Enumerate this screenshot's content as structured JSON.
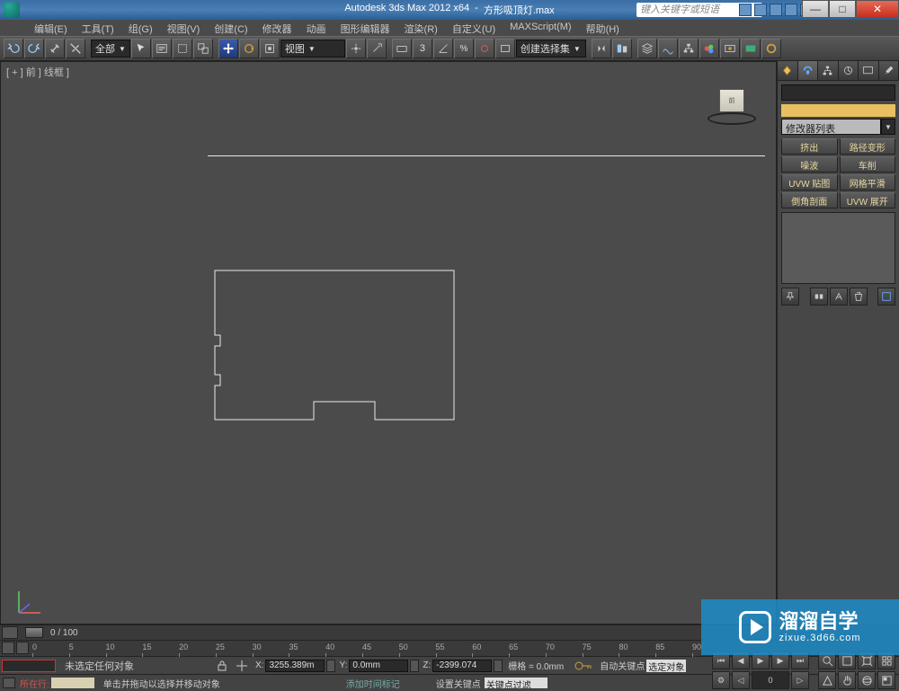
{
  "title": {
    "app": "Autodesk 3ds Max 2012 x64",
    "dash": "-",
    "file": "方形吸顶灯.max"
  },
  "search_placeholder": "键入关键字或短语",
  "menus": [
    "编辑(E)",
    "工具(T)",
    "组(G)",
    "视图(V)",
    "创建(C)",
    "修改器",
    "动画",
    "图形编辑器",
    "渲染(R)",
    "自定义(U)",
    "MAXScript(M)",
    "帮助(H)"
  ],
  "toolbar": {
    "sel_filter": "全部",
    "view_label": "视图",
    "three_label": "3",
    "named_sel": "创建选择集"
  },
  "viewport": {
    "label": "[ + ] 前 ] 线框 ]",
    "cube_face": "前"
  },
  "panel": {
    "modlist": "修改器列表",
    "buttons": [
      "挤出",
      "路径变形",
      "噪波",
      "车削",
      "UVW 贴图",
      "网格平滑",
      "倒角剖面",
      "UVW 展开"
    ]
  },
  "track": {
    "frames": "0 / 100"
  },
  "ruler_ticks": [
    0,
    5,
    10,
    15,
    20,
    25,
    30,
    35,
    40,
    45,
    50,
    55,
    60,
    65,
    70,
    75,
    80,
    85,
    90
  ],
  "status": {
    "no_sel": "未选定任何对象",
    "x": "3255.389m",
    "y": "0.0mm",
    "z": "-2399.074",
    "grid": "栅格 = 0.0mm",
    "autokey": "自动关键点",
    "autobox": "选定对象",
    "nowline": "所在行:",
    "hint": "单击并拖动以选择并移动对象",
    "addtag": "添加时间标记",
    "setkey": "设置关键点",
    "filter": "关键点过滤器..."
  },
  "watermark": {
    "big": "溜溜自学",
    "sm": "zixue.3d66.com"
  }
}
